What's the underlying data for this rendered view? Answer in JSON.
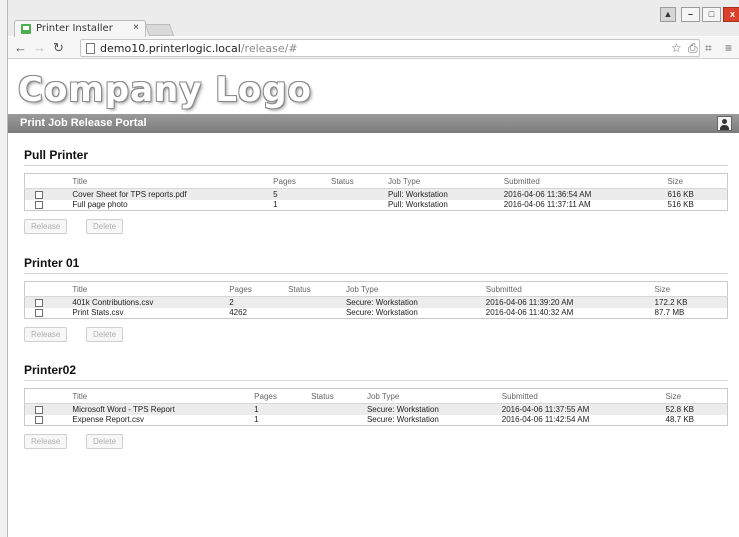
{
  "browser": {
    "tab_title": "Printer Installer",
    "tab_close": "×",
    "url_host": "demo10.printerlogic.local",
    "url_path": "/release/#"
  },
  "header": {
    "logo_text": "Company Logo",
    "portal_title": "Print Job Release Portal"
  },
  "columns": [
    "Title",
    "Pages",
    "Status",
    "Job Type",
    "Submitted",
    "Size"
  ],
  "buttons": {
    "release": "Release",
    "delete": "Delete"
  },
  "printers": [
    {
      "name": "Pull Printer",
      "jobs": [
        {
          "title": "Cover Sheet for TPS reports.pdf",
          "pages": "5",
          "status": "",
          "job_type": "Pull: Workstation",
          "submitted": "2016-04-06 11:36:54 AM",
          "size": "616 KB"
        },
        {
          "title": "Full page photo",
          "pages": "1",
          "status": "",
          "job_type": "Pull: Workstation",
          "submitted": "2016-04-06 11:37:11 AM",
          "size": "516 KB"
        }
      ]
    },
    {
      "name": "Printer 01",
      "jobs": [
        {
          "title": "401k Contributions.csv",
          "pages": "2",
          "status": "",
          "job_type": "Secure: Workstation",
          "submitted": "2016-04-06 11:39:20 AM",
          "size": "172.2 KB"
        },
        {
          "title": "Print Stats.csv",
          "pages": "4262",
          "status": "",
          "job_type": "Secure: Workstation",
          "submitted": "2016-04-06 11:40:32 AM",
          "size": "87.7 MB"
        }
      ]
    },
    {
      "name": "Printer02",
      "jobs": [
        {
          "title": "Microsoft Word - TPS Report",
          "pages": "1",
          "status": "",
          "job_type": "Secure: Workstation",
          "submitted": "2016-04-06 11:37:55 AM",
          "size": "52.8 KB"
        },
        {
          "title": "Expense Report.csv",
          "pages": "1",
          "status": "",
          "job_type": "Secure: Workstation",
          "submitted": "2016-04-06 11:42:54 AM",
          "size": "48.7 KB"
        }
      ]
    }
  ]
}
